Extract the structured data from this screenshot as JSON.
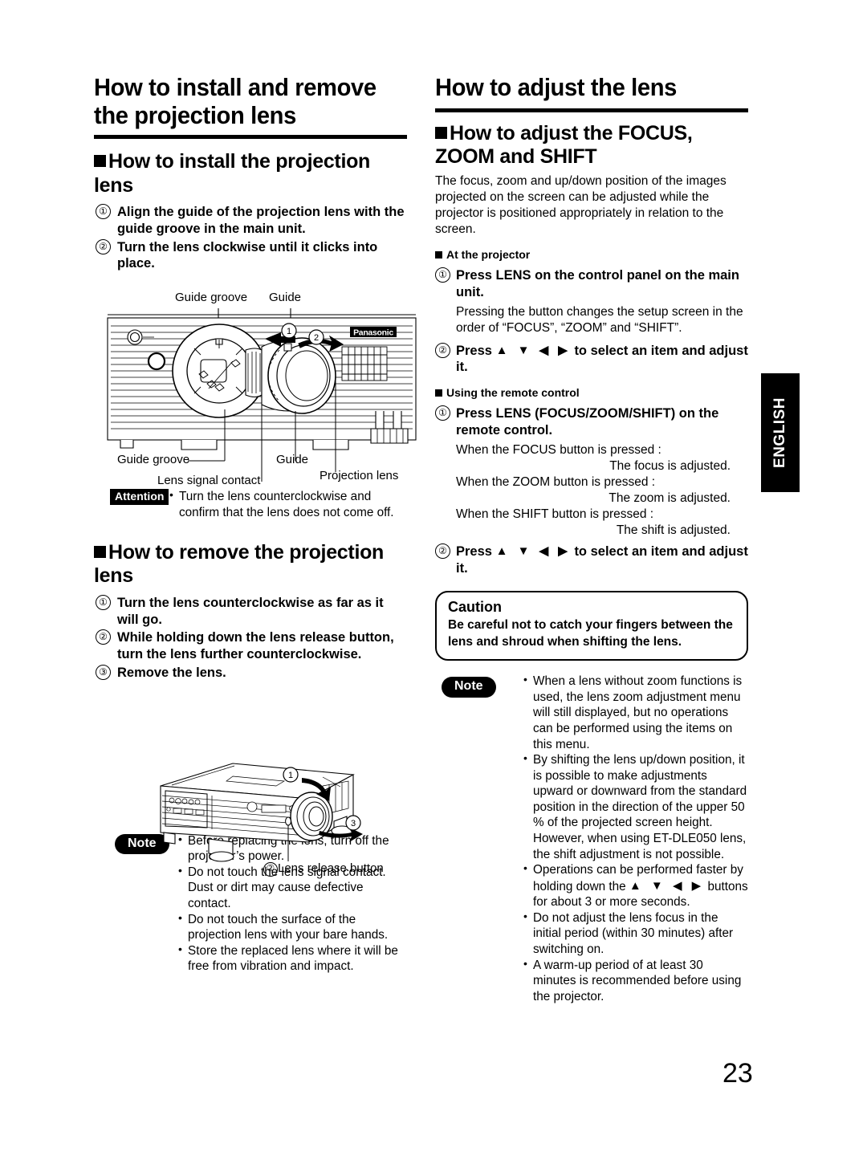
{
  "page": {
    "number": "23",
    "language_tab": "ENGLISH"
  },
  "left_column": {
    "chapter_title": "How to install and remove the projection lens",
    "section1": {
      "heading": "How to install the projection lens",
      "steps": [
        {
          "num": "①",
          "text": "Align the guide of the projection lens with the guide groove in the main unit."
        },
        {
          "num": "②",
          "text": "Turn the lens clockwise until it clicks into place."
        }
      ]
    },
    "figure1": {
      "labels": {
        "guide_groove_top": "Guide groove",
        "guide_top": "Guide",
        "guide_groove_bottom": "Guide groove",
        "guide_bottom": "Guide",
        "lens_signal_contact": "Lens signal contact",
        "projection_lens": "Projection lens",
        "brand": "Panasonic",
        "callout1": "①",
        "callout2": "②"
      }
    },
    "attention": {
      "badge": "Attention",
      "bullets": [
        "Turn the lens counterclockwise and confirm that the lens does not come off."
      ]
    },
    "section2": {
      "heading": "How to remove the projection lens",
      "steps": [
        {
          "num": "①",
          "text": "Turn the lens counterclockwise as far as it will go."
        },
        {
          "num": "②",
          "text": "While holding down the lens release button, turn the lens further counterclockwise."
        },
        {
          "num": "③",
          "text": "Remove the lens."
        }
      ]
    },
    "figure2": {
      "labels": {
        "callout1": "①",
        "callout3": "③",
        "lens_release_button": "Lens release button",
        "lens_release_num": "②"
      }
    },
    "note": {
      "badge": "Note",
      "bullets": [
        "Before replacing the lens, turn off the projector’s power.",
        "Do not touch the lens signal contact. Dust or dirt may cause defective contact.",
        "Do not touch the surface of the projection lens with your bare hands.",
        "Store the replaced lens where it will be free from vibration and impact."
      ]
    }
  },
  "right_column": {
    "chapter_title": "How to adjust the lens",
    "section_heading": "How to adjust the FOCUS, ZOOM and SHIFT",
    "intro": "The focus, zoom and up/down position of the images projected on the screen can be adjusted while the projector is positioned appropriately in relation to the screen.",
    "at_projector": {
      "sub_head": "At the projector",
      "step1_num": "①",
      "step1": "Press LENS on the control panel on the main unit.",
      "step1_detail": "Pressing the button changes the setup screen in the order of “FOCUS”, “ZOOM” and “SHIFT”.",
      "step2_num": "②",
      "step2_prefix": "Press",
      "step2_arrows": "▲ ▼ ◀ ▶",
      "step2_suffix": "to select an item and adjust it."
    },
    "remote_control": {
      "sub_head": "Using the remote control",
      "step1_num": "①",
      "step1": "Press LENS (FOCUS/ZOOM/SHIFT) on the remote control.",
      "pairs": [
        {
          "q": "When the FOCUS button is pressed :",
          "a": "The focus is adjusted."
        },
        {
          "q": "When the ZOOM button is pressed :",
          "a": "The zoom is adjusted."
        },
        {
          "q": "When the SHIFT button is pressed :",
          "a": "The shift is adjusted."
        }
      ],
      "step2_num": "②",
      "step2_prefix": "Press",
      "step2_arrows": "▲ ▼ ◀ ▶",
      "step2_suffix": "to select an item and adjust it."
    },
    "caution": {
      "title": "Caution",
      "body": "Be careful not to catch your fingers between the lens and shroud when shifting the lens."
    },
    "note": {
      "badge": "Note",
      "bullets": [
        "When a lens without zoom functions is used, the lens zoom adjustment menu will still displayed, but no operations can be performed using the items on this menu.",
        "By shifting the lens up/down position, it is possible to make adjustments upward or downward from the standard position in the direction of the upper 50 % of the projected screen height. However, when using ET-DLE050 lens, the shift adjustment is not possible.",
        "Do not adjust the lens focus in the initial period (within 30 minutes) after switching on.",
        "A warm-up period of at least 30 minutes is recommended before using the projector."
      ],
      "bullet3_prefix": "Operations can be performed faster by holding down the",
      "bullet3_arrows": "▲ ▼ ◀ ▶",
      "bullet3_suffix": "buttons for about 3 or more seconds."
    }
  }
}
